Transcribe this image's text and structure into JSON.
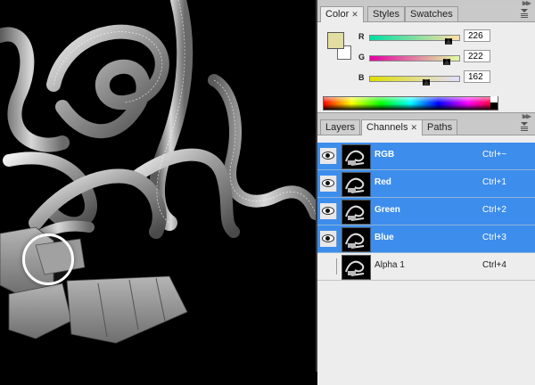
{
  "color_panel": {
    "tabs": [
      {
        "label": "Color",
        "close": "✕",
        "active": true
      },
      {
        "label": "Styles",
        "active": false
      },
      {
        "label": "Swatches",
        "active": false
      }
    ],
    "foreground_color": "#e2dea2",
    "sliders": [
      {
        "label": "R",
        "value": "226",
        "level": 0.886,
        "gradient": "linear-gradient(to right,#00dea2,#ffdea2)"
      },
      {
        "label": "G",
        "value": "222",
        "level": 0.871,
        "gradient": "linear-gradient(to right,#e200a2,#e2ffa2)"
      },
      {
        "label": "B",
        "value": "162",
        "level": 0.635,
        "gradient": "linear-gradient(to right,#e2de00,#e2deff)"
      }
    ]
  },
  "channels_panel": {
    "tabs": [
      {
        "label": "Layers",
        "active": false
      },
      {
        "label": "Channels",
        "close": "✕",
        "active": true
      },
      {
        "label": "Paths",
        "active": false
      }
    ],
    "channels": [
      {
        "name": "RGB",
        "shortcut": "Ctrl+~",
        "selected": true,
        "visible": true
      },
      {
        "name": "Red",
        "shortcut": "Ctrl+1",
        "selected": true,
        "visible": true
      },
      {
        "name": "Green",
        "shortcut": "Ctrl+2",
        "selected": true,
        "visible": true
      },
      {
        "name": "Blue",
        "shortcut": "Ctrl+3",
        "selected": true,
        "visible": true
      },
      {
        "name": "Alpha 1",
        "shortcut": "Ctrl+4",
        "selected": false,
        "visible": false
      }
    ]
  }
}
